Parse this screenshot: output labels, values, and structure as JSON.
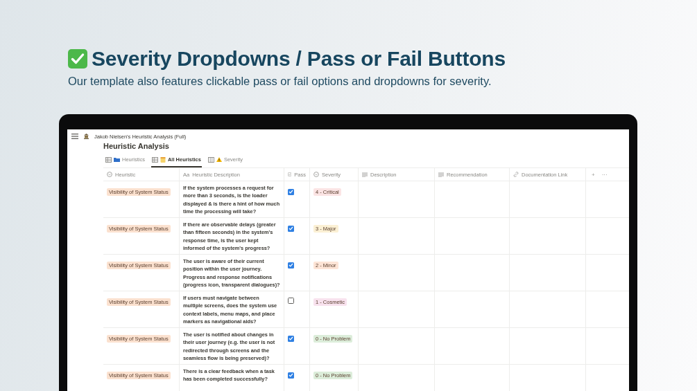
{
  "hero": {
    "title": "Severity Dropdowns / Pass or Fail Buttons",
    "subtitle": "Our template also features clickable pass or fail options and  dropdowns for severity."
  },
  "app": {
    "breadcrumb": "Jakob Nielsen's Heuristic Analysis (Full)",
    "page_title": "Heuristic Analysis",
    "tabs": [
      {
        "label": "Heuristics",
        "kind": "table",
        "selected": false
      },
      {
        "label": "All Heuristics",
        "kind": "table",
        "selected": true
      },
      {
        "label": "Severity",
        "kind": "board",
        "selected": false
      }
    ],
    "columns": [
      {
        "label": "Heuristic",
        "kind": "select"
      },
      {
        "label": "Heuristic Description",
        "kind": "title",
        "icon_text": "Aa"
      },
      {
        "label": "Pass",
        "kind": "checkbox"
      },
      {
        "label": "Severity",
        "kind": "select"
      },
      {
        "label": "Description",
        "kind": "text"
      },
      {
        "label": "Recommendation",
        "kind": "text"
      },
      {
        "label": "Documentation Link",
        "kind": "url"
      }
    ],
    "header_actions": [
      "+",
      "···"
    ],
    "rows": [
      {
        "heuristic": "Visibility of System Status",
        "description": "If the system processes a request for more than 3 seconds, is the loader displayed & is there a hint of how much time the processing will take?",
        "pass": true,
        "severity": "4 - Critical",
        "color": "#fbe4e4"
      },
      {
        "heuristic": "Visibility of System Status",
        "description": "If there are observable delays (greater than fifteen seconds) in the system's response time, is the user kept informed of the system's progress?",
        "pass": true,
        "severity": "3 - Major",
        "color": "#fbf0d4"
      },
      {
        "heuristic": "Visibility of System Status",
        "description": "The user is aware of their current position within the user journey. Progress and response notifications (progress icon, transparent dialogues)?",
        "pass": true,
        "severity": "2 - Minor",
        "color": "#fde4d6"
      },
      {
        "heuristic": "Visibility of System Status",
        "description": "If users must navigate between multiple screens, does the system use context labels, menu maps, and place markers as navigational aids?",
        "pass": false,
        "severity": "1 - Cosmetic",
        "color": "#f8e2ee"
      },
      {
        "heuristic": "Visibility of System Status",
        "description": "The user is notified about changes in their user journey (e.g. the user is not redirected through screens and the seamless flow is being preserved)?",
        "pass": true,
        "severity": "0 - No Problem",
        "color": "#dcedda"
      },
      {
        "heuristic": "Visibility of System Status",
        "description": "There is a clear feedback when a task has been completed successfully?",
        "pass": true,
        "severity": "0 - No Problem",
        "color": "#dcedda"
      }
    ]
  }
}
